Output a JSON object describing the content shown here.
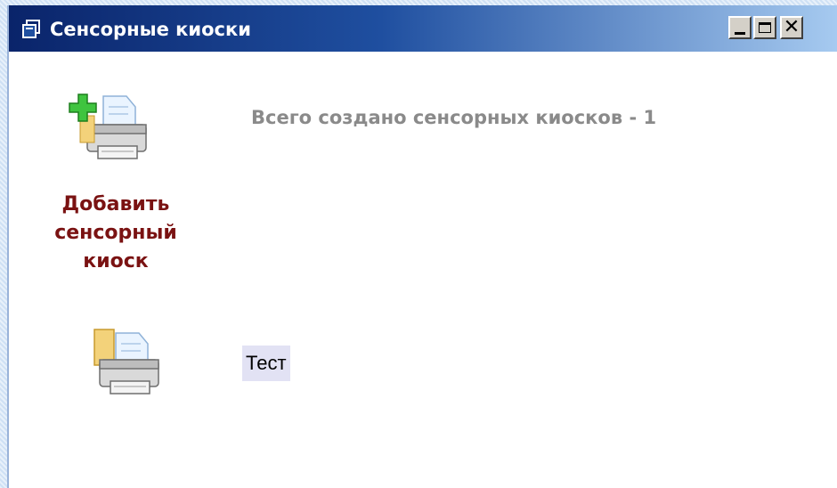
{
  "window": {
    "title": "Сенсорные киоски",
    "title_icon": "window-restore-icon",
    "controls": {
      "minimize_icon": "minimize-icon",
      "maximize_icon": "maximize-icon",
      "close_icon": "close-icon"
    },
    "titlebar_colors": [
      "#0a246a",
      "#a6caf0"
    ]
  },
  "main": {
    "add_action": {
      "icon": "add-printer-icon",
      "label": "Добавить сенсорный киоск",
      "label_color": "#7a1212"
    },
    "summary_text": "Всего создано сенсорных киосков - 1",
    "kiosks": [
      {
        "icon": "printer-icon",
        "name": "Тест"
      }
    ]
  }
}
